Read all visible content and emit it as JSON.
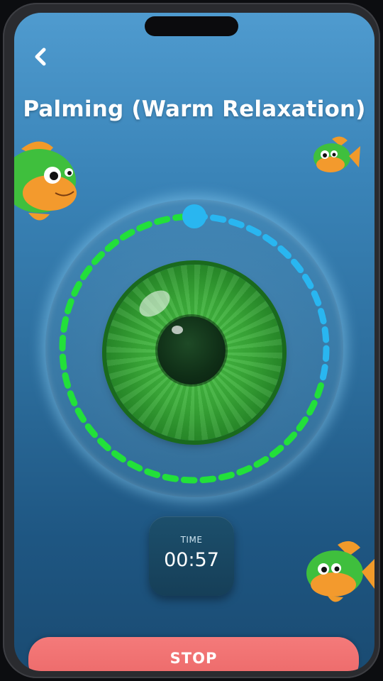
{
  "header": {
    "back_icon": "chevron-left-icon",
    "title": "Palming (Warm Relaxation)"
  },
  "exercise": {
    "progress_fraction": 0.15,
    "progress_color_done": "#22e03a",
    "progress_color_remaining": "#29b6f0",
    "knob_color": "#29b6f0"
  },
  "timer": {
    "label": "TIME",
    "value": "00:57"
  },
  "actions": {
    "stop_label": "STOP",
    "stop_color": "#f27373"
  },
  "colors": {
    "background_top": "#4f9bcf",
    "background_bottom": "#1a4b72"
  }
}
